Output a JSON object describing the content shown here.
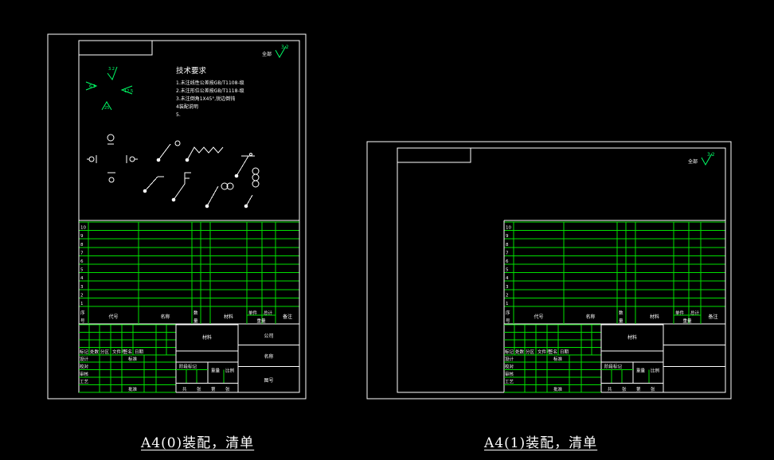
{
  "sheets": [
    {
      "caption": "A4(0)装配，清单",
      "roughness": {
        "label": "全部",
        "value": "3.2"
      },
      "tech_title": "技术要求",
      "tech_items": [
        "1.未注线性公差按GB/T1108-级",
        "2.未注形位公差按GB/T1118-级",
        "3.未注倒角1X45°,锐边倒钝",
        "4装配说明",
        "5."
      ],
      "symbol_values": [
        "3.2",
        "6.3",
        "12.5",
        "25"
      ],
      "row_numbers": [
        "10",
        "9",
        "8",
        "7",
        "6",
        "5",
        "4",
        "3",
        "2",
        "1"
      ],
      "bom_header": [
        "序号",
        "代号",
        "名称",
        "数量",
        "材料",
        "单件",
        "总计",
        "重量",
        "备注"
      ],
      "title_block": {
        "material": "材料",
        "company": "公司",
        "part_name": "名称",
        "drawing_no": "图号",
        "rev_row": [
          "标记",
          "处数",
          "分区",
          "文件号",
          "签名",
          "日期"
        ],
        "roles": [
          "设计",
          "校对",
          "审核",
          "工艺"
        ],
        "standard": "标准",
        "approve": "批准",
        "stage_mark": "阶段标记",
        "weight": "重量",
        "scale": "比例",
        "sheets_info": [
          "共",
          "张",
          "第",
          "张"
        ]
      }
    },
    {
      "caption": "A4(1)装配，清单",
      "roughness": {
        "label": "全部",
        "value": "3.2"
      },
      "row_numbers": [
        "10",
        "9",
        "8",
        "7",
        "6",
        "5",
        "4",
        "3",
        "2",
        "1"
      ],
      "bom_header": [
        "序号",
        "代号",
        "名称",
        "数量",
        "材料",
        "单件",
        "总计",
        "重量",
        "备注"
      ],
      "title_block": {
        "material": "材料",
        "rev_row": [
          "标记",
          "处数",
          "分区",
          "文件号",
          "签名",
          "日期"
        ],
        "roles": [
          "设计",
          "校对",
          "审核",
          "工艺"
        ],
        "standard": "标准",
        "approve": "批准",
        "stage_mark": "阶段标记",
        "weight": "重量",
        "scale": "比例",
        "sheets_info": [
          "共",
          "张",
          "第",
          "张"
        ]
      }
    }
  ],
  "colors": {
    "background": "#000000",
    "frame": "#ffffff",
    "table": "#00e000",
    "symbol": "#00ff66"
  }
}
